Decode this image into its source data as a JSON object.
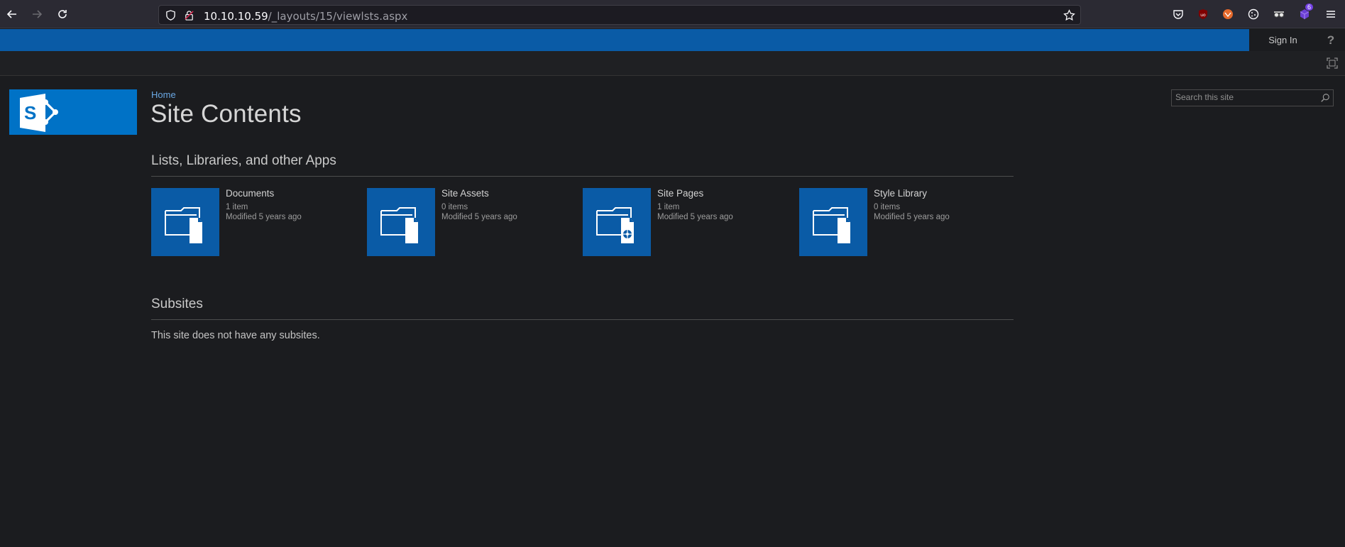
{
  "browser": {
    "url_host": "10.10.10.59",
    "url_path": "/_layouts/15/viewlsts.aspx",
    "extension_badge": "6"
  },
  "suite": {
    "sign_in": "Sign In",
    "help": "?"
  },
  "header": {
    "breadcrumb": "Home",
    "title": "Site Contents",
    "search_placeholder": "Search this site"
  },
  "apps": {
    "heading": "Lists, Libraries, and other Apps",
    "tiles": [
      {
        "name": "Documents",
        "count": "1 item",
        "modified": "Modified 5 years ago",
        "icon": "document-library-icon"
      },
      {
        "name": "Site Assets",
        "count": "0 items",
        "modified": "Modified 5 years ago",
        "icon": "document-library-icon"
      },
      {
        "name": "Site Pages",
        "count": "1 item",
        "modified": "Modified 5 years ago",
        "icon": "page-library-icon"
      },
      {
        "name": "Style Library",
        "count": "0 items",
        "modified": "Modified 5 years ago",
        "icon": "document-library-icon"
      }
    ]
  },
  "subsites": {
    "heading": "Subsites",
    "empty_text": "This site does not have any subsites."
  },
  "colors": {
    "suite_bar": "#0a5ba6",
    "logo_bg": "#0072c6",
    "background": "#1b1c1f",
    "link": "#6aa8e4"
  }
}
